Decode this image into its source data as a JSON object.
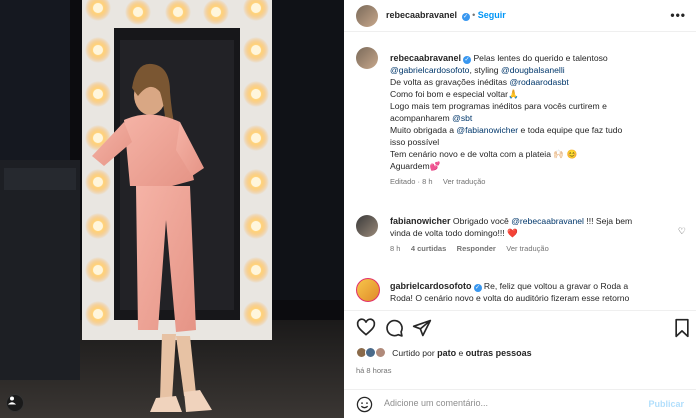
{
  "post": {
    "username": "rebecaabravanel",
    "follow_label": "Seguir",
    "more_label": "•••",
    "caption_lines": [
      "Pelas lentes do querido e talentoso",
      "@gabrielcardosofoto, styling @dougbalsanelli",
      "De volta as gravações inéditas @rodaarodasbt",
      "Como foi bom e especial voltar🙏",
      "Logo mais tem programas inéditos para vocês curtirem e",
      "acompanharem @sbt",
      "Muito obrigada a @fabianowicher e toda equipe que faz tudo",
      "isso possível",
      "Tem cenário novo e de volta com a plateia 🙌🏻 😊",
      "Aguardem💕"
    ],
    "caption_meta": {
      "edited": "Editado · 8 h",
      "translate": "Ver tradução"
    }
  },
  "comments": [
    {
      "username": "fabianowicher",
      "text_line1": "Obrigado você @rebecaabravanel !!! Seja bem",
      "text_line2": "vinda de volta todo domingo!!! ❤️",
      "time": "8 h",
      "likes": "4 curtidas",
      "reply": "Responder",
      "translate": "Ver tradução"
    },
    {
      "username": "gabrielcardosofoto",
      "text_line1": "Re, feliz que voltou a gravar o Roda a",
      "text_line2": "Roda! O cenário novo e volta do auditório fizeram esse retorno"
    }
  ],
  "likes_text": {
    "prefix": "Curtido por ",
    "first": "pato",
    "middle": " e ",
    "rest": "outras pessoas"
  },
  "timestamp": "há 8 horas",
  "comment_box": {
    "placeholder": "Adicione um comentário...",
    "publish_label": "Publicar"
  },
  "colors": {
    "accent": "#0095f6",
    "verified": "#3897f0",
    "heart": "#ed4956",
    "outfit": "#f2a79a"
  }
}
